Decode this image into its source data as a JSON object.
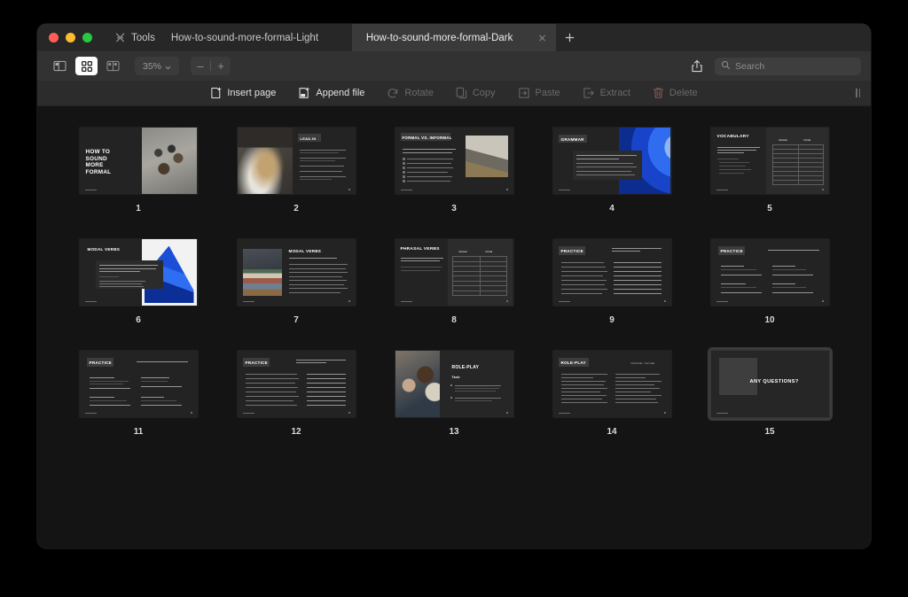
{
  "window": {
    "traffic_lights": [
      "close",
      "minimize",
      "maximize"
    ],
    "tools_label": "Tools",
    "tabs": [
      {
        "title": "How-to-sound-more-formal-Light",
        "active": false
      },
      {
        "title": "How-to-sound-more-formal-Dark",
        "active": true
      }
    ],
    "new_tab_label": "+"
  },
  "toolbar": {
    "view_sidebar_icon": "sidebar-icon",
    "view_grid_icon": "grid-icon",
    "view_split_icon": "split-view-icon",
    "zoom_level": "35%",
    "zoom_out_label": "–",
    "zoom_in_label": "+",
    "share_icon": "share-icon",
    "search_icon": "search-icon",
    "search_placeholder": "Search",
    "search_value": ""
  },
  "actions": [
    {
      "label": "Insert page",
      "icon": "insert-page-icon",
      "enabled": true
    },
    {
      "label": "Append file",
      "icon": "append-file-icon",
      "enabled": true
    },
    {
      "label": "Rotate",
      "icon": "rotate-icon",
      "enabled": false
    },
    {
      "label": "Copy",
      "icon": "copy-icon",
      "enabled": false
    },
    {
      "label": "Paste",
      "icon": "paste-icon",
      "enabled": false
    },
    {
      "label": "Extract",
      "icon": "extract-icon",
      "enabled": false
    },
    {
      "label": "Delete",
      "icon": "trash-icon",
      "enabled": false
    }
  ],
  "colors": {
    "window_bg": "#1c1c1c",
    "titlebar_bg": "#272727",
    "active_tab_bg": "#3a3a3a",
    "toolbar_bg": "#323232",
    "actionbar_bg": "#2c2c2c",
    "content_bg": "#141414",
    "selection": "#3b3b3b",
    "accent_blue": "#2f6cf0",
    "delete_red": "#d06a6a"
  },
  "pages": [
    {
      "number": "1",
      "title": "HOW TO SOUND MORE FORMAL",
      "layout": "cover-photo-right",
      "selected": false
    },
    {
      "number": "2",
      "title": "LEAD-IN",
      "layout": "photo-left-bullets",
      "selected": false
    },
    {
      "number": "3",
      "title": "FORMAL VS. INFORMAL",
      "layout": "checklist-photo-right",
      "selected": false
    },
    {
      "number": "4",
      "title": "GRAMMAR",
      "layout": "callout-blue-curve",
      "selected": false
    },
    {
      "number": "5",
      "title": "VOCABULARY",
      "layout": "table-two-column",
      "table_headers": [
        "Informal",
        "Formal"
      ],
      "selected": false
    },
    {
      "number": "6",
      "title": "MODAL VERBS",
      "layout": "callout-blue-wedge",
      "selected": false
    },
    {
      "number": "7",
      "title": "MODAL VERBS",
      "layout": "photo-left-gapfill",
      "selected": false
    },
    {
      "number": "8",
      "title": "PHRASAL VERBS",
      "layout": "table-two-column",
      "table_headers": [
        "Informal",
        "Formal"
      ],
      "selected": false
    },
    {
      "number": "9",
      "title": "PRACTICE",
      "layout": "numbered-answer-lines",
      "subtitle": "Rewrite the following informal sentences into formal sentences",
      "selected": false
    },
    {
      "number": "10",
      "title": "PRACTICE",
      "layout": "four-quadrant",
      "subtitle": "Make the sentences more formal using the target words",
      "selected": false
    },
    {
      "number": "11",
      "title": "PRACTICE",
      "layout": "four-quadrant",
      "subtitle": "Make the sentences more formal using the target words",
      "selected": false
    },
    {
      "number": "12",
      "title": "PRACTICE",
      "layout": "numbered-answer-lines",
      "subtitle": "Rewrite the following formal sentences into informal sentences",
      "selected": false
    },
    {
      "number": "13",
      "title": "ROLE-PLAY",
      "layout": "photo-left-task",
      "subtitle": "Task:",
      "selected": false
    },
    {
      "number": "14",
      "title": "ROLE-PLAY",
      "layout": "two-column-list",
      "subtitle": "Informal  /  Formal",
      "selected": false
    },
    {
      "number": "15",
      "title": "ANY QUESTIONS?",
      "layout": "closing",
      "selected": true
    }
  ]
}
